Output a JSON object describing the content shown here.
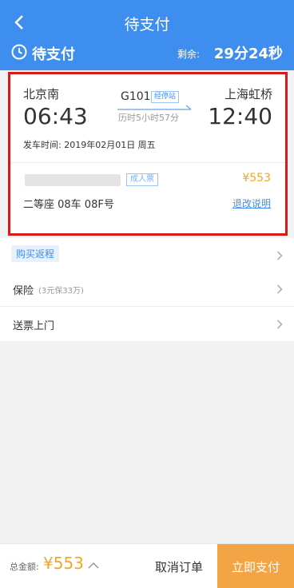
{
  "header": {
    "title": "待支付",
    "status": "待支付",
    "remaining_label": "剩余:",
    "remaining_time": "29分24秒",
    "accent_color": "#3e8ef0"
  },
  "trip": {
    "from_station": "北京南",
    "to_station": "上海虹桥",
    "departure_time": "06:43",
    "arrival_time": "12:40",
    "train_number": "G101",
    "stops_link": "经停站",
    "duration": "历时5小时57分",
    "departure_date": "发车时间: 2019年02月01日 周五"
  },
  "passenger": {
    "ticket_type": "成人票",
    "price": "¥553",
    "seat": "二等座 08车 08F号",
    "refund_link": "退改说明"
  },
  "options": {
    "buy_return": "购买返程",
    "insurance_label": "保险",
    "insurance_sub": "(3元保33万)",
    "delivery_label": "送票上门"
  },
  "footer": {
    "total_label": "总金额:",
    "total_value": "¥553",
    "cancel_label": "取消订单",
    "pay_label": "立即支付",
    "pay_color": "#f3a444"
  },
  "icons": [
    "back-arrow-icon",
    "clock-icon",
    "chevron-right-icon",
    "chevron-up-icon"
  ]
}
